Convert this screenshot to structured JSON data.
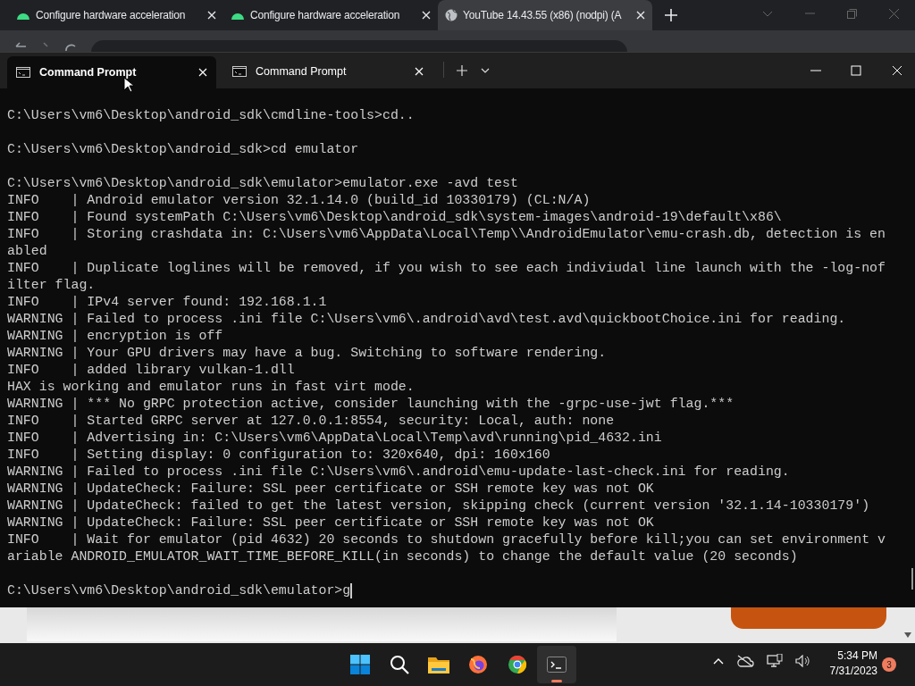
{
  "browser": {
    "tabs": [
      {
        "title": "Configure hardware acceleration",
        "kind": "android",
        "selected": false
      },
      {
        "title": "Configure hardware acceleration",
        "kind": "android",
        "selected": false
      },
      {
        "title": "YouTube 14.43.55 (x86) (nodpi) (A",
        "kind": "globe",
        "selected": true
      }
    ]
  },
  "terminal": {
    "tabs": [
      {
        "title": "Command Prompt",
        "selected": true
      },
      {
        "title": "Command Prompt",
        "selected": false
      }
    ],
    "blocks": [
      [
        "C:\\Users\\vm6\\Desktop\\android_sdk\\cmdline-tools>cd.."
      ],
      [
        "C:\\Users\\vm6\\Desktop\\android_sdk>cd emulator"
      ],
      [
        "C:\\Users\\vm6\\Desktop\\android_sdk\\emulator>emulator.exe -avd test",
        "INFO    | Android emulator version 32.1.14.0 (build_id 10330179) (CL:N/A)",
        "INFO    | Found systemPath C:\\Users\\vm6\\Desktop\\android_sdk\\system-images\\android-19\\default\\x86\\",
        "INFO    | Storing crashdata in: C:\\Users\\vm6\\AppData\\Local\\Temp\\\\AndroidEmulator\\emu-crash.db, detection is en",
        "abled",
        "INFO    | Duplicate loglines will be removed, if you wish to see each indiviudal line launch with the -log-nof",
        "ilter flag.",
        "INFO    | IPv4 server found: 192.168.1.1",
        "WARNING | Failed to process .ini file C:\\Users\\vm6\\.android\\avd\\test.avd\\quickbootChoice.ini for reading.",
        "WARNING | encryption is off",
        "WARNING | Your GPU drivers may have a bug. Switching to software rendering.",
        "INFO    | added library vulkan-1.dll",
        "HAX is working and emulator runs in fast virt mode.",
        "WARNING | *** No gRPC protection active, consider launching with the -grpc-use-jwt flag.***",
        "INFO    | Started GRPC server at 127.0.0.1:8554, security: Local, auth: none",
        "INFO    | Advertising in: C:\\Users\\vm6\\AppData\\Local\\Temp\\avd\\running\\pid_4632.ini",
        "INFO    | Setting display: 0 configuration to: 320x640, dpi: 160x160",
        "WARNING | Failed to process .ini file C:\\Users\\vm6\\.android\\emu-update-last-check.ini for reading.",
        "WARNING | UpdateCheck: Failure: SSL peer certificate or SSH remote key was not OK",
        "WARNING | UpdateCheck: failed to get the latest version, skipping check (current version '32.1.14-10330179')",
        "WARNING | UpdateCheck: Failure: SSL peer certificate or SSH remote key was not OK",
        "INFO    | Wait for emulator (pid 4632) 20 seconds to shutdown gracefully before kill;you can set environment v",
        "ariable ANDROID_EMULATOR_WAIT_TIME_BEFORE_KILL(in seconds) to change the default value (20 seconds)"
      ],
      [
        "C:\\Users\\vm6\\Desktop\\android_sdk\\emulator>g"
      ]
    ]
  },
  "taskbar": {
    "apps": [
      {
        "kind": "start",
        "active": false
      },
      {
        "kind": "search",
        "active": false
      },
      {
        "kind": "folder",
        "active": false
      },
      {
        "kind": "firefox",
        "active": false
      },
      {
        "kind": "chrome",
        "active": false
      },
      {
        "kind": "terminal",
        "active": true
      }
    ],
    "time": "5:34 PM",
    "date": "7/31/2023",
    "notifications": "3"
  }
}
